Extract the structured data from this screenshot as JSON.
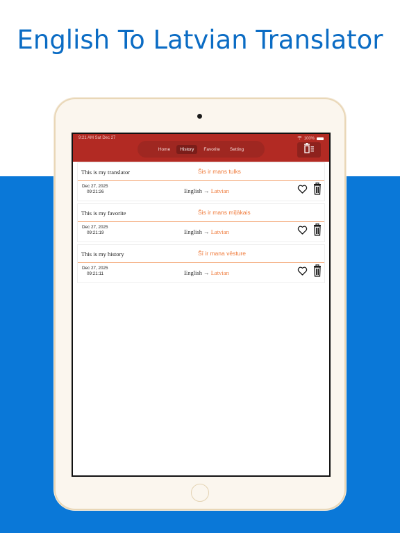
{
  "headline": "English To Latvian Translator",
  "status_bar": {
    "time": "9:21 AM   Sat Dec 27",
    "battery": "100%"
  },
  "tabs": [
    {
      "label": "Home",
      "active": false
    },
    {
      "label": "History",
      "active": true
    },
    {
      "label": "Favorite",
      "active": false
    },
    {
      "label": "Setting",
      "active": false
    }
  ],
  "toolbar": {
    "clear_icon": "trash-list-icon"
  },
  "history": [
    {
      "source": "This is my translator",
      "translation": "Šis ir mans tulks",
      "date": "Dec 27, 2025",
      "time": "09:21:26",
      "from": "English →",
      "to": "Latvian"
    },
    {
      "source": "This is my favorite",
      "translation": "Šis ir mans mīļākais",
      "date": "Dec 27, 2025",
      "time": "09:21:19",
      "from": "English →",
      "to": "Latvian"
    },
    {
      "source": "This is my history",
      "translation": "Šī ir mana vēsture",
      "date": "Dec 27, 2025",
      "time": "09:21:11",
      "from": "English →",
      "to": "Latvian"
    }
  ],
  "colors": {
    "appbar": "#b22a23",
    "accent": "#ef7a3a",
    "headline": "#0b6cc4",
    "background_blue": "#0a78d8"
  }
}
